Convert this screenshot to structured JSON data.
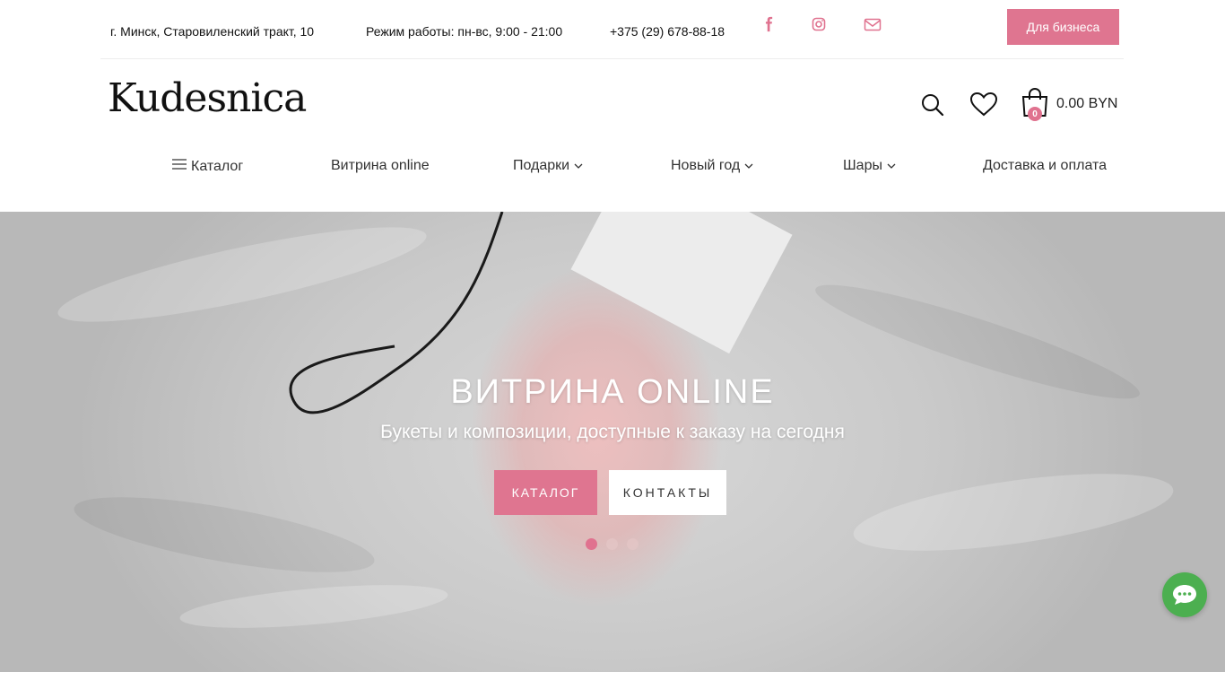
{
  "topbar": {
    "address": "г. Минск, Старовиленский тракт, 10",
    "hours": "Режим работы: пн-вс, 9:00 - 21:00",
    "phone": "+375 (29) 678-88-18",
    "social_icons": [
      "facebook-icon",
      "instagram-icon",
      "mail-icon"
    ],
    "business_button": "Для бизнеса"
  },
  "header": {
    "logo": "Kudesnica",
    "cart_count": "0",
    "cart_total": "0.00 BYN"
  },
  "nav": {
    "items": [
      {
        "label": "Каталог",
        "icon": "menu-icon"
      },
      {
        "label": "Витрина online"
      },
      {
        "label": "Подарки",
        "dropdown": true
      },
      {
        "label": "Новый год",
        "dropdown": true
      },
      {
        "label": "Шары",
        "dropdown": true
      },
      {
        "label": "Доставка и оплата"
      }
    ]
  },
  "hero": {
    "title": "ВИТРИНА ONLINE",
    "subtitle": "Букеты и композиции, доступные к заказу на сегодня",
    "primary_button": "КАТАЛОГ",
    "secondary_button": "КОНТАКТЫ",
    "slides_count": 3,
    "active_slide": 1
  },
  "colors": {
    "accent": "#df7590",
    "chat": "#4caf50"
  }
}
